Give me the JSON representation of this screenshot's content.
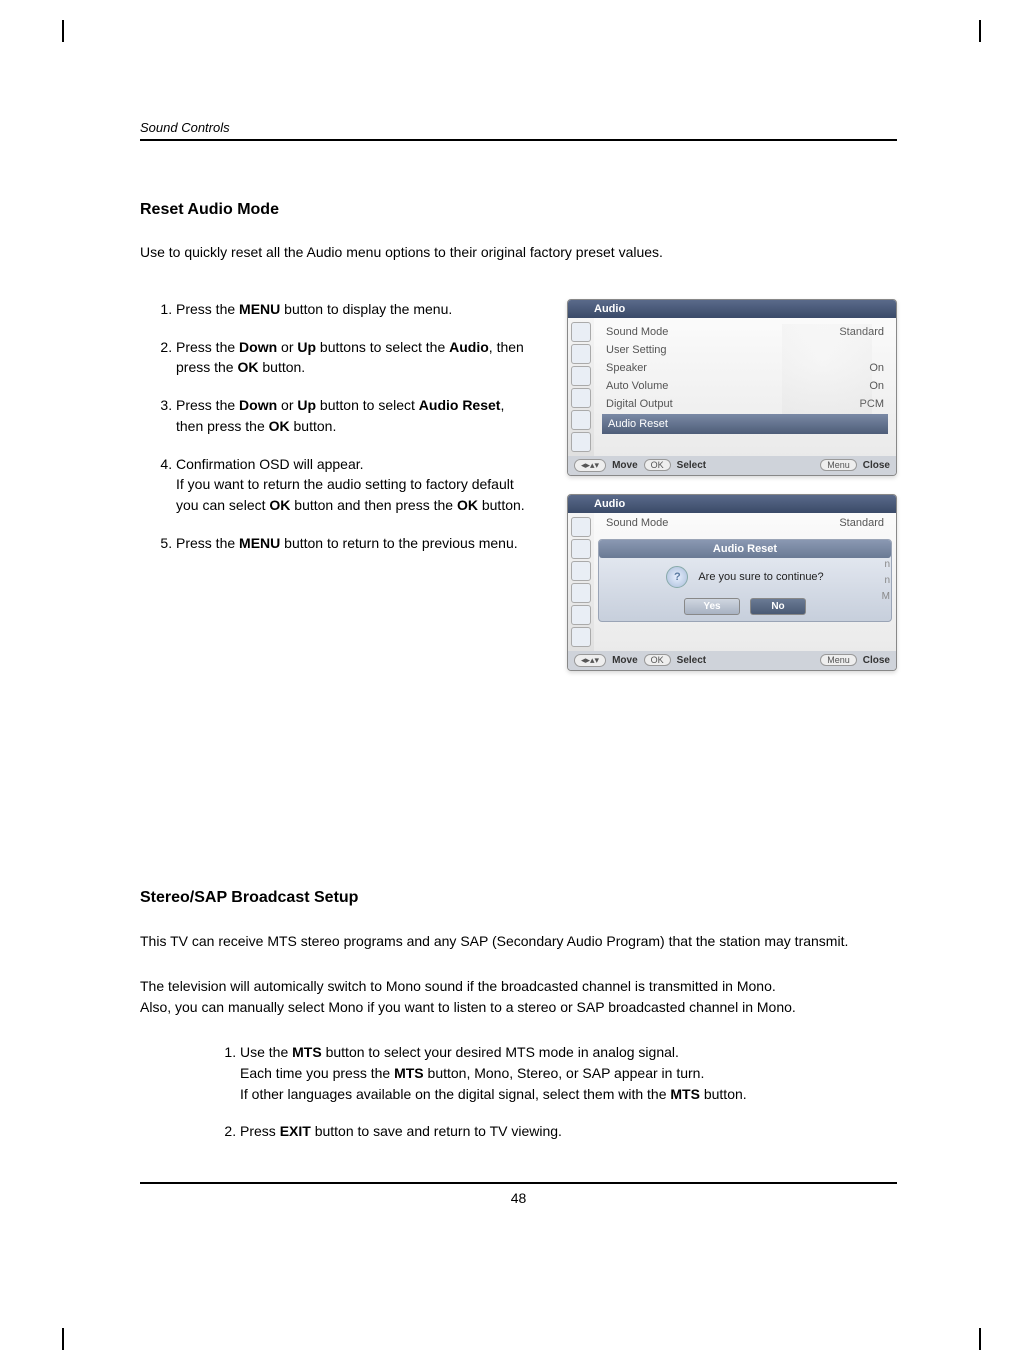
{
  "header": {
    "section_label": "Sound Controls"
  },
  "section1": {
    "title": "Reset Audio Mode",
    "intro": "Use to quickly reset all the Audio menu options to their original factory preset values.",
    "steps": [
      {
        "pre": "Press the ",
        "b1": "MENU",
        "post": " button to display the menu."
      },
      {
        "pre": "Press the ",
        "b1": "Down",
        "mid1": "  or  ",
        "b2": "Up",
        "mid2": " buttons to select the ",
        "b3": "Audio",
        "post": ", then press the ",
        "b4": "OK",
        "tail": " button."
      },
      {
        "pre": "Press the ",
        "b1": "Down",
        "mid1": "  or  ",
        "b2": "Up",
        "mid2": " button to select ",
        "b3": "Audio Reset",
        "post": ", then press the ",
        "b4": "OK",
        "tail": " button."
      },
      {
        "line1": "Confirmation OSD will appear.",
        "line2a": "If you want to return the audio setting to factory default you can select ",
        "b1": "OK",
        "line2b": " button and then press the ",
        "b2": "OK",
        "line2c": " button."
      },
      {
        "pre": "Press the ",
        "b1": "MENU",
        "post": " button to return to the previous menu."
      }
    ]
  },
  "osd1": {
    "title": "Audio",
    "rows": [
      {
        "label": "Sound Mode",
        "value": "Standard"
      },
      {
        "label": "User Setting",
        "value": ""
      },
      {
        "label": "Speaker",
        "value": "On"
      },
      {
        "label": "Auto Volume",
        "value": "On"
      },
      {
        "label": "Digital Output",
        "value": "PCM"
      }
    ],
    "selected": {
      "label": "Audio Reset",
      "value": ""
    },
    "footer": {
      "nav_glyph": "◂▸▴▾",
      "move": "Move",
      "ok": "OK",
      "select": "Select",
      "menu": "Menu",
      "close": "Close"
    }
  },
  "osd2": {
    "title": "Audio",
    "pre_row": {
      "label": "Sound Mode",
      "value": "Standard"
    },
    "dialog": {
      "title": "Audio Reset",
      "question": "Are you sure to continue?",
      "yes": "Yes",
      "no": "No"
    },
    "partial_values": {
      "v1": "n",
      "v2": "n",
      "v3": "M"
    },
    "footer": {
      "nav_glyph": "◂▸▴▾",
      "move": "Move",
      "ok": "OK",
      "select": "Select",
      "menu": "Menu",
      "close": "Close"
    }
  },
  "section2": {
    "title": "Stereo/SAP Broadcast Setup",
    "intro1": "This TV can receive MTS stereo programs and any SAP (Secondary Audio Program) that the station may transmit.",
    "intro2a": "The television will automically switch to Mono sound if the broadcasted channel is transmitted in Mono.",
    "intro2b": "Also, you can manually select Mono if you want to listen to a stereo or SAP broadcasted channel in Mono.",
    "steps": [
      {
        "l1a": "Use the ",
        "b1": "MTS",
        "l1b": " button to select your desired MTS mode in analog signal.",
        "l2a": "Each time you press the ",
        "b2": "MTS",
        "l2b": " button, Mono, Stereo, or SAP appear in turn.",
        "l3a": "If other languages available on the digital signal, select them with the ",
        "b3": "MTS",
        "l3b": " button."
      },
      {
        "l1a": "Press ",
        "b1": "EXIT",
        "l1b": " button to save and return to TV viewing."
      }
    ]
  },
  "page_number": "48"
}
